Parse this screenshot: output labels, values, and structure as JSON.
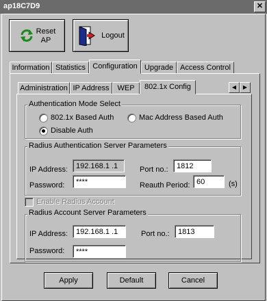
{
  "window": {
    "title": "ap18C7D9"
  },
  "toolbar": {
    "reset_label_line1": "Reset",
    "reset_label_line2": "AP",
    "logout_label": "Logout"
  },
  "main_tabs": [
    "Information",
    "Statistics",
    "Configuration",
    "Upgrade",
    "Access Control"
  ],
  "main_tab_active": "Configuration",
  "sub_tabs": [
    "Administration",
    "IP Address",
    "WEP",
    "802.1x Config"
  ],
  "sub_tab_active": "802.1x Config",
  "auth_mode": {
    "title": "Authentication Mode Select",
    "opt1": "802.1x Based Auth",
    "opt2": "Mac Address Based Auth",
    "opt3": "Disable Auth",
    "selected": "Disable Auth"
  },
  "radius_auth": {
    "title": "Radius Authentication Server Parameters",
    "ip_label": "IP Address:",
    "ip_value": "192.168.1  .1",
    "port_label": "Port no.:",
    "port_value": "1812",
    "password_label": "Password:",
    "password_value": "****",
    "reauth_label": "Reauth Period:",
    "reauth_value": "60",
    "reauth_unit": "(s)"
  },
  "enable_radius_account": {
    "label": "Enable Radius Account",
    "checked": false
  },
  "radius_account": {
    "title": "Radius Account Server Parameters",
    "ip_label": "IP Address:",
    "ip_value": "192.168.1  .1",
    "port_label": "Port no.:",
    "port_value": "1813",
    "password_label": "Password:",
    "password_value": "****"
  },
  "buttons": {
    "apply": "Apply",
    "default": "Default",
    "cancel": "Cancel"
  }
}
